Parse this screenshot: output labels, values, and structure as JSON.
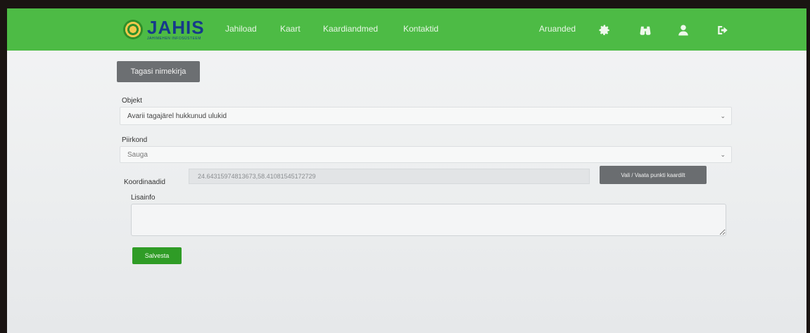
{
  "header": {
    "logo_text": "JAHIS",
    "logo_subtitle": "JAHIMEHEN INFOSÜSTEEM",
    "nav": {
      "jahiload": "Jahiload",
      "kaart": "Kaart",
      "kaardiandmed": "Kaardiandmed",
      "kontaktid": "Kontaktid",
      "aruanded": "Aruanded"
    },
    "icons": [
      "gear-icon",
      "binoculars-icon",
      "user-icon",
      "logout-icon"
    ],
    "bar_color": "#4dbb45"
  },
  "form": {
    "back_button": "Tagasi nimekirja",
    "objekt": {
      "label": "Objekt",
      "value": "Avarii tagajärel hukkunud ulukid"
    },
    "piirkond": {
      "label": "Piirkond",
      "value": "Sauga"
    },
    "koordinaadid": {
      "label": "Koordinaadid",
      "value": "24.64315974813673,58.41081545172729",
      "button": "Vali / Vaata punkti kaardilt"
    },
    "lisainfo": {
      "label": "Lisainfo",
      "value": ""
    },
    "save_button": "Salvesta",
    "save_color": "#2f9c26"
  }
}
